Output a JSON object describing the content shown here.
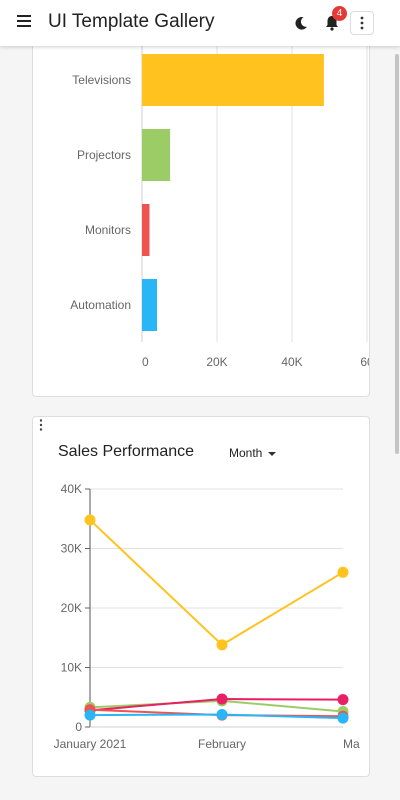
{
  "appbar": {
    "title": "UI Template Gallery",
    "menu_icon": "hamburger-menu-icon",
    "theme_icon": "moon-icon",
    "notifications_icon": "bell-icon",
    "notifications_count": "4",
    "more_icon": "more-vertical-icon"
  },
  "colors": {
    "yellow": "#FFC21F",
    "green": "#9CCC65",
    "red": "#EF5350",
    "blue": "#29B6F6",
    "pink": "#E91E63",
    "badge": "#E53935"
  },
  "chart_data": [
    {
      "type": "bar",
      "orientation": "horizontal",
      "categories": [
        "Televisions",
        "Projectors",
        "Monitors",
        "Automation"
      ],
      "values": [
        48500,
        7500,
        2000,
        4000
      ],
      "bar_colors": [
        "#FFC21F",
        "#9CCC65",
        "#EF5350",
        "#29B6F6"
      ],
      "x_ticks": [
        "0",
        "20K",
        "40K",
        "60"
      ],
      "xlim": [
        0,
        60000
      ],
      "grid": true
    },
    {
      "type": "line",
      "title": "Sales Performance",
      "period_label": "Month",
      "menu_icon": "more-vertical-icon",
      "x": [
        "January 2021",
        "February",
        "March"
      ],
      "x_tick_labels": [
        "January 2021",
        "February",
        "Ma"
      ],
      "y_ticks": [
        "40K",
        "30K",
        "20K",
        "10K",
        "0"
      ],
      "ylim": [
        0,
        40000
      ],
      "grid": true,
      "series": [
        {
          "color": "#FFC21F",
          "values": [
            34800,
            13800,
            26000
          ]
        },
        {
          "color": "#9CCC65",
          "values": [
            3300,
            4400,
            2600
          ]
        },
        {
          "color": "#E91E63",
          "values": [
            2800,
            4700,
            4600
          ]
        },
        {
          "color": "#EF5350",
          "values": [
            2900,
            2000,
            1800
          ]
        },
        {
          "color": "#29B6F6",
          "values": [
            2000,
            2100,
            1500
          ]
        }
      ]
    }
  ]
}
